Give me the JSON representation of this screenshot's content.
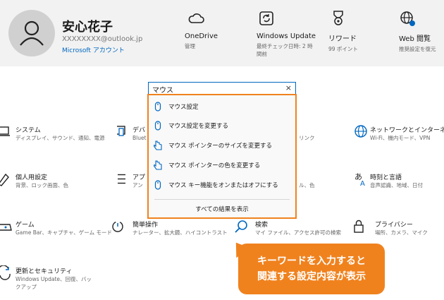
{
  "header": {
    "user_name": "安心花子",
    "email": "XXXXXXXX@outlook.jp",
    "account_link": "Microsoft アカウント",
    "items": [
      {
        "title": "OneDrive",
        "sub": "管理"
      },
      {
        "title": "Windows Update",
        "sub": "最終チェック日時: 2 時間前"
      },
      {
        "title": "リワード",
        "sub": "99 ポイント"
      },
      {
        "title": "Web 閲覧",
        "sub": "推奨設定を復元"
      }
    ]
  },
  "search": {
    "value": "マウス",
    "close": "×"
  },
  "dropdown": {
    "items": [
      {
        "label": "マウス設定",
        "icon": "mouse-icon"
      },
      {
        "label": "マウス設定を変更する",
        "icon": "mouse-icon"
      },
      {
        "label": "マウス ポインターのサイズを変更する",
        "icon": "pointer-hand-icon"
      },
      {
        "label": "マウス ポインターの色を変更する",
        "icon": "pointer-hand-icon"
      },
      {
        "label": "マウス キー機能をオンまたはオフにする",
        "icon": "mouse-icon"
      }
    ],
    "all_results": "すべての結果を表示"
  },
  "categories": [
    {
      "title": "システム",
      "sub": "ディスプレイ、サウンド、通知、電源"
    },
    {
      "title": "デバ",
      "sub": "Bluet"
    },
    {
      "title": "",
      "sub": "リンク"
    },
    {
      "title": "ネットワークとインターネット",
      "sub": "Wi-Fi、機内モード、VPN"
    },
    {
      "title": "個人用設定",
      "sub": "背景、ロック画面、色"
    },
    {
      "title": "アプ",
      "sub": "アン"
    },
    {
      "title": "",
      "sub": "ル、色"
    },
    {
      "title": "時刻と言語",
      "sub": "音声認識、地域、日付"
    },
    {
      "title": "ゲーム",
      "sub": "Game Bar、キャプチャ、ゲーム モード"
    },
    {
      "title": "簡単操作",
      "sub": "ナレーター、拡大鏡、ハイコントラスト"
    },
    {
      "title": "検索",
      "sub": "マイ ファイル、アクセス許可の検索"
    },
    {
      "title": "プライバシー",
      "sub": "場所、カメラ、マイク"
    },
    {
      "title": "更新とセキュリティ",
      "sub": "Windows Update、回復、バックアップ"
    }
  ],
  "callout": {
    "line1": "キーワードを入力すると",
    "line2": "関連する設定内容が表示"
  },
  "colors": {
    "accent": "#0067c0",
    "callout": "#f0821e"
  }
}
